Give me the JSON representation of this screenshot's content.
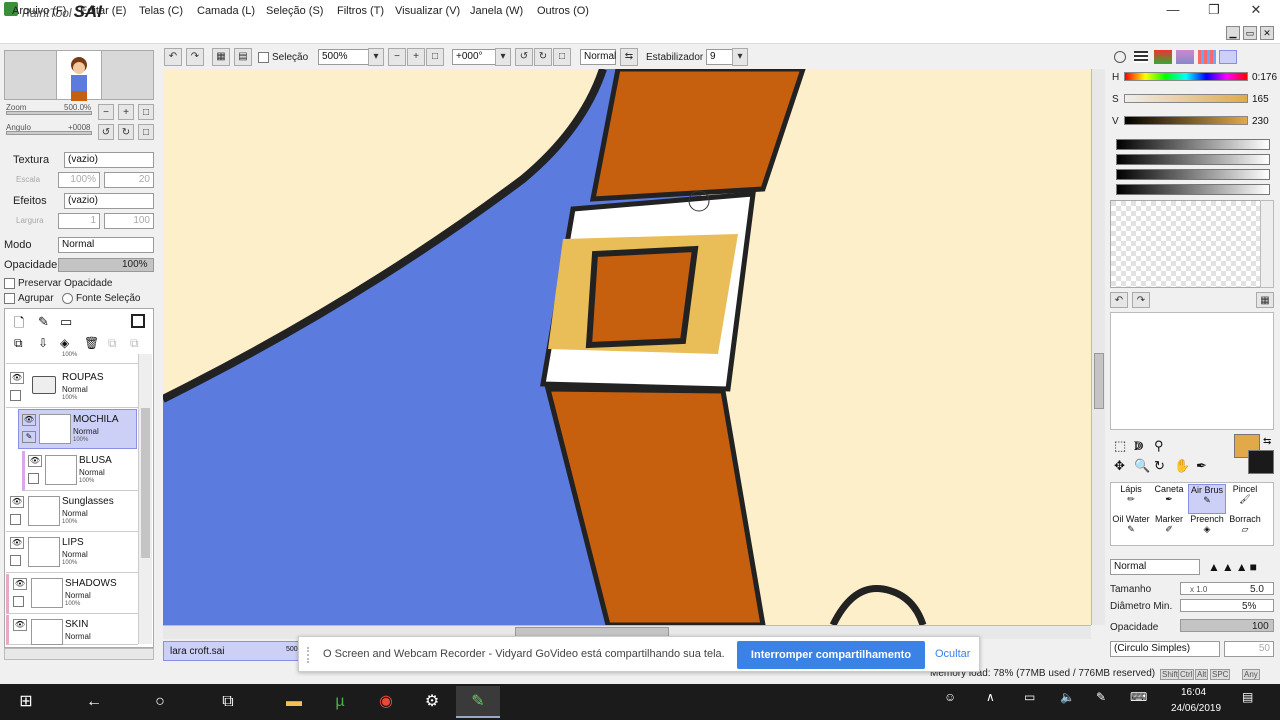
{
  "app": {
    "name_prefix": "PaintTool",
    "name": "SAI"
  },
  "window_controls": {
    "minimize": "—",
    "restore": "❐",
    "close": "✕"
  },
  "menu": [
    "Arquivo (F)",
    "Editar (E)",
    "Telas (C)",
    "Camada (L)",
    "Seleção (S)",
    "Filtros (T)",
    "Visualizar (V)",
    "Janela (W)",
    "Outros (O)"
  ],
  "toolbar": {
    "selection_label": "Seleção",
    "zoom": "500%",
    "rotation": "+000°",
    "blend": "Normal",
    "stabilizer_label": "Estabilizador",
    "stabilizer_value": "9"
  },
  "navigator": {
    "zoom_label": "Zoom",
    "zoom_value": "500.0%",
    "angle_label": "Angulo",
    "angle_value": "+0008"
  },
  "texture": {
    "label": "Textura",
    "value": "(vazio)",
    "scale_label": "Escala",
    "scale_value": "100%",
    "strength": "20"
  },
  "effects": {
    "label": "Efeitos",
    "value": "(vazio)",
    "width_label": "Largura",
    "width_value": "1",
    "strength": "100"
  },
  "mode": {
    "label": "Modo",
    "value": "Normal"
  },
  "opacity": {
    "label": "Opacidade",
    "value": "100%"
  },
  "checks": {
    "preserve": "Preservar Opacidade",
    "group": "Agrupar",
    "source": "Fonte Seleção"
  },
  "layers": [
    {
      "name": "ROUPAS",
      "mode": "Normal",
      "pct": "100%",
      "folder": true
    },
    {
      "name": "MOCHILA",
      "mode": "Normal",
      "pct": "100%",
      "selected": true
    },
    {
      "name": "BLUSA",
      "mode": "Normal",
      "pct": "100%"
    },
    {
      "name": "Sunglasses",
      "mode": "Normal",
      "pct": "100%"
    },
    {
      "name": "LIPS",
      "mode": "Normal",
      "pct": "100%"
    },
    {
      "name": "SHADOWS",
      "mode": "Normal",
      "pct": "100%"
    },
    {
      "name": "SKIN",
      "mode": "Normal",
      "pct": "100%"
    }
  ],
  "layer_top_pct": "100%",
  "file_tab": {
    "name": "lara croft.sai",
    "pct": "500"
  },
  "color": {
    "h_label": "H",
    "h_value": "0:176",
    "s_label": "S",
    "s_value": "165",
    "v_label": "V",
    "v_value": "230",
    "primary": "#e2a94a",
    "secondary": "#1a1a1a"
  },
  "tools": [
    "Lápis",
    "Caneta",
    "Air Brus",
    "Pincel",
    "Oil Water",
    "Marker",
    "Preench",
    "Borrach"
  ],
  "brush": {
    "mode": "Normal",
    "size_label": "Tamanho",
    "size_mult": "x 1.0",
    "size_value": "5.0",
    "min_label": "Diâmetro Min.",
    "min_value": "5%",
    "opacity_label": "Opacidade",
    "opacity_value": "100",
    "shape": "(Circulo Simples)",
    "shape_value": "50"
  },
  "status": {
    "memory": "Memory load: 78% (77MB used / 776MB reserved)",
    "keys": [
      "Shift",
      "Ctrl",
      "Alt",
      "SPC",
      "Any"
    ]
  },
  "notification": {
    "text": "O Screen and Webcam Recorder - Vidyard GoVideo está compartilhando sua tela.",
    "stop": "Interromper compartilhamento",
    "hide": "Ocultar"
  },
  "taskbar": {
    "time": "16:04",
    "date": "24/06/2019"
  },
  "colors": {
    "blue": "#5b7bde",
    "brown": "#c6600e",
    "yellow": "#e9bd58",
    "cream": "#fcefc9",
    "accent": "#3b82e6"
  }
}
